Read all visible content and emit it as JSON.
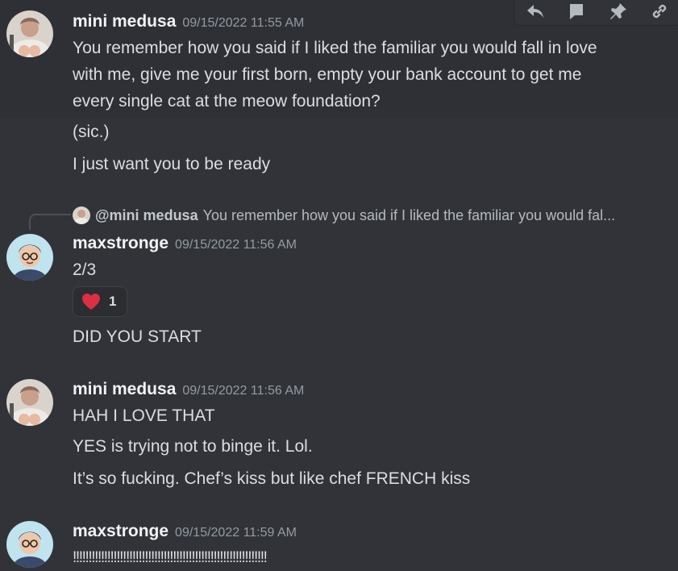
{
  "toolbar": {
    "icons": [
      "reply-icon",
      "thread-icon",
      "pin-icon",
      "link-icon"
    ]
  },
  "messages": [
    {
      "username": "mini medusa",
      "timestamp": "09/15/2022 11:55 AM",
      "lines": [
        "You remember how you said if I liked the familiar you would fall in love",
        "with me, give me your first born, empty your bank account to get me",
        "every single cat at the meow foundation?",
        "(sic.)",
        "I just want you to be ready"
      ]
    },
    {
      "reply_to": {
        "mention": "@mini medusa",
        "preview": "You remember how you said if I liked the familiar you would fal..."
      },
      "username": "maxstronge",
      "timestamp": "09/15/2022 11:56 AM",
      "lines": [
        "2/3",
        "DID YOU START"
      ],
      "reaction": {
        "emoji": "heart-icon",
        "count": "1",
        "color": "#dd2e44"
      }
    },
    {
      "username": "mini medusa",
      "timestamp": "09/15/2022 11:56 AM",
      "lines": [
        "HAH I LOVE THAT",
        "YES is trying not to binge it. Lol.",
        "It’s so fucking. Chef’s kiss but like chef FRENCH kiss"
      ]
    },
    {
      "username": "maxstronge",
      "timestamp": "09/15/2022 11:59 AM",
      "lines": [
        "!!!!!!!!!!!!!!!!!!!!!!!!!!!!!!!!!!!!!!!!!!!!!!!!!!!!!!!!!!!!!!"
      ]
    }
  ],
  "colors": {
    "background": "#313338",
    "username": "#f2f3f5",
    "timestamp": "#949ba4",
    "text": "#dbdee1"
  }
}
